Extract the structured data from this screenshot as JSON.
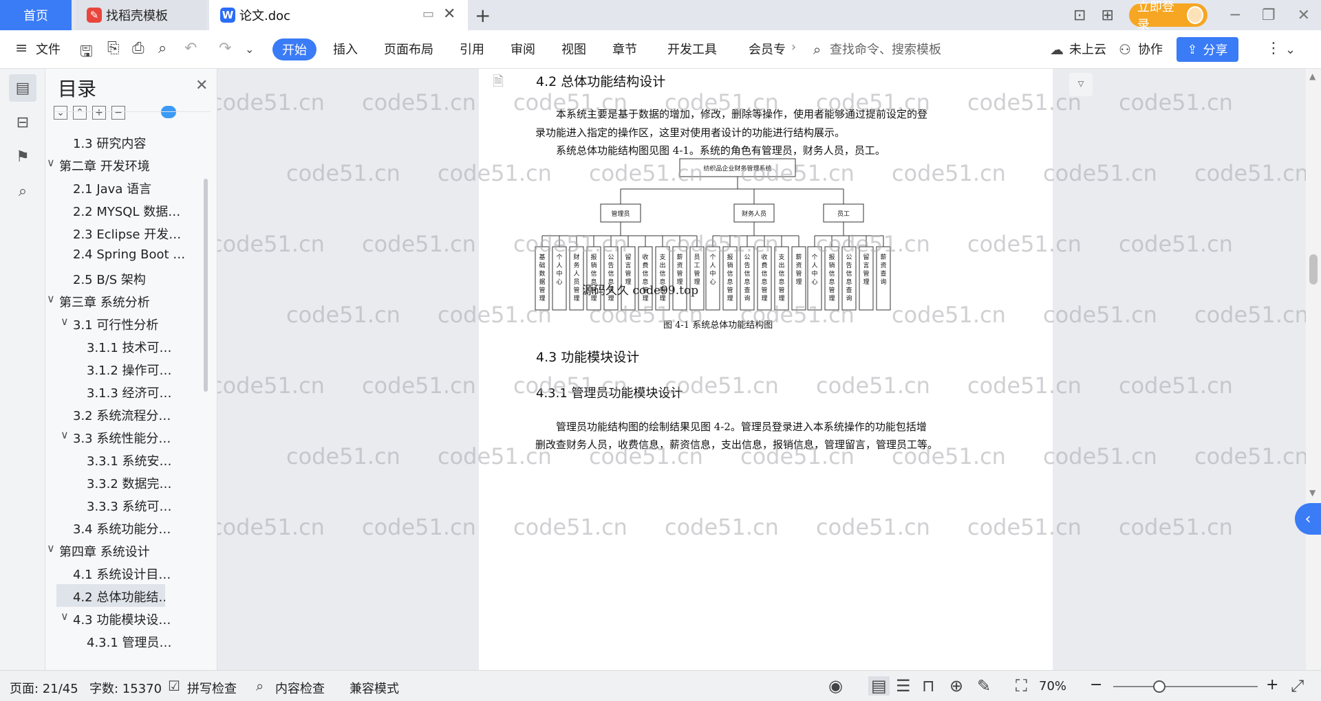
{
  "tabs": {
    "home": "首页",
    "template": "找稻壳模板",
    "doc": "论文.doc"
  },
  "titlebar": {
    "login": "立即登录"
  },
  "ribbon": {
    "file": "文件",
    "start": "开始",
    "insert": "插入",
    "layout": "页面布局",
    "reference": "引用",
    "review": "审阅",
    "view": "视图",
    "chapter": "章节",
    "devtools": "开发工具",
    "member": "会员专",
    "search_placeholder": "查找命令、搜索模板",
    "cloud": "未上云",
    "collab": "协作",
    "share": "分享"
  },
  "toc": {
    "title": "目录",
    "items": [
      {
        "label": "1.3  研究内容",
        "level": 2,
        "arrow": ""
      },
      {
        "label": "第二章  开发环境",
        "level": 1,
        "arrow": "∨"
      },
      {
        "label": "2.1 Java 语言",
        "level": 2,
        "arrow": ""
      },
      {
        "label": "2.2 MYSQL 数据…",
        "level": 2,
        "arrow": ""
      },
      {
        "label": "2.3 Eclipse 开发…",
        "level": 2,
        "arrow": ""
      },
      {
        "label": "2.4 Spring Boot …",
        "level": 2,
        "arrow": ""
      },
      {
        "label": "2.5 B/S 架构",
        "level": 2,
        "arrow": ""
      },
      {
        "label": "第三章  系统分析",
        "level": 1,
        "arrow": "∨"
      },
      {
        "label": "3.1 可行性分析",
        "level": 2,
        "arrow": "∨"
      },
      {
        "label": "3.1.1 技术可…",
        "level": 3,
        "arrow": ""
      },
      {
        "label": "3.1.2 操作可…",
        "level": 3,
        "arrow": ""
      },
      {
        "label": "3.1.3 经济可…",
        "level": 3,
        "arrow": ""
      },
      {
        "label": "3.2 系统流程分…",
        "level": 2,
        "arrow": ""
      },
      {
        "label": "3.3 系统性能分…",
        "level": 2,
        "arrow": "∨"
      },
      {
        "label": "3.3.1 系统安…",
        "level": 3,
        "arrow": ""
      },
      {
        "label": "3.3.2 数据完…",
        "level": 3,
        "arrow": ""
      },
      {
        "label": "3.3.3 系统可…",
        "level": 3,
        "arrow": ""
      },
      {
        "label": "3.4 系统功能分…",
        "level": 2,
        "arrow": ""
      },
      {
        "label": "第四章  系统设计",
        "level": 1,
        "arrow": "∨"
      },
      {
        "label": "4.1  系统设计目…",
        "level": 2,
        "arrow": ""
      },
      {
        "label": "4.2  总体功能结…",
        "level": 2,
        "arrow": "",
        "active": true
      },
      {
        "label": "4.3  功能模块设…",
        "level": 2,
        "arrow": "∨"
      },
      {
        "label": "4.3.1  管理员…",
        "level": 3,
        "arrow": ""
      }
    ]
  },
  "document": {
    "heading_42": "4.2  总体功能结构设计",
    "para1_line1": "本系统主要是基于数据的增加，修改，删除等操作，使用者能够通过提前设定的登",
    "para1_line2": "录功能进入指定的操作区，这里对使用者设计的功能进行结构展示。",
    "para2": "系统总体功能结构图见图 4-1。系统的角色有管理员，财务人员，员工。",
    "figure_caption": "图 4-1  系统总体功能结构图",
    "overlay_text": "源码久久 code99.top",
    "heading_43": "4.3  功能模块设计",
    "heading_431": "4.3.1  管理员功能模块设计",
    "para3_line1": "管理员功能结构图的绘制结果见图 4-2。管理员登录进入本系统操作的功能包括增",
    "para3_line2": "删改查财务人员，收费信息，薪资信息，支出信息，报销信息，管理留言，管理员工等。"
  },
  "diagram": {
    "root": "纺织品企业财务管理系统",
    "roles": [
      "管理员",
      "财务人员",
      "员工"
    ],
    "admin_leaves": [
      "基础数据管理",
      "个人中心",
      "财务人员管理",
      "报销信息管理",
      "公告信息管理",
      "留言管理",
      "收费信息管理",
      "支出信息管理",
      "薪资管理",
      "员工管理"
    ],
    "finance_leaves": [
      "个人中心",
      "报销信息管理",
      "公告信息查询",
      "收费信息管理",
      "支出信息管理",
      "薪资管理"
    ],
    "staff_leaves": [
      "个人中心",
      "报销信息管理",
      "公告信息查询",
      "留言管理",
      "薪资查询"
    ]
  },
  "watermark": "code51.cn",
  "status": {
    "page": "页面: 21/45",
    "words": "字数: 15370",
    "spell": "拼写检查",
    "content": "内容检查",
    "compat": "兼容模式",
    "zoom": "70%"
  }
}
